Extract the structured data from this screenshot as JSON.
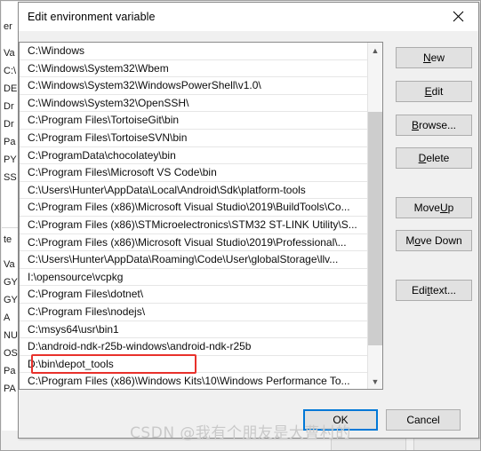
{
  "dialog": {
    "title": "Edit environment variable",
    "close_icon": "close-icon"
  },
  "background_window": {
    "left_text_fragments": [
      "er",
      "Va",
      "C:\\",
      "DE",
      "Dr",
      "Dr",
      "Pa",
      "PY",
      "SS",
      "te",
      "Va",
      "GY",
      "GY",
      "A",
      "NU",
      "OS",
      "Pa",
      "PA"
    ]
  },
  "path_list": {
    "items": [
      "C:\\Windows",
      "C:\\Windows\\System32\\Wbem",
      "C:\\Windows\\System32\\WindowsPowerShell\\v1.0\\",
      "C:\\Windows\\System32\\OpenSSH\\",
      "C:\\Program Files\\TortoiseGit\\bin",
      "C:\\Program Files\\TortoiseSVN\\bin",
      "C:\\ProgramData\\chocolatey\\bin",
      "C:\\Program Files\\Microsoft VS Code\\bin",
      "C:\\Users\\Hunter\\AppData\\Local\\Android\\Sdk\\platform-tools",
      "C:\\Program Files (x86)\\Microsoft Visual Studio\\2019\\BuildTools\\Co...",
      "C:\\Program Files (x86)\\STMicroelectronics\\STM32 ST-LINK Utility\\S...",
      "C:\\Program Files (x86)\\Microsoft Visual Studio\\2019\\Professional\\...",
      "C:\\Users\\Hunter\\AppData\\Roaming\\Code\\User\\globalStorage\\llv...",
      "I:\\opensource\\vcpkg",
      "C:\\Program Files\\dotnet\\",
      "C:\\Program Files\\nodejs\\",
      "C:\\msys64\\usr\\bin1",
      "D:\\android-ndk-r25b-windows\\android-ndk-r25b",
      "D:\\bin\\depot_tools",
      "C:\\Program Files (x86)\\Windows Kits\\10\\Windows Performance To...",
      "",
      ""
    ],
    "highlighted_index": 18,
    "highlight_color": "#e8312b",
    "scrollbar": {
      "up_arrow_icon": "chevron-up-icon",
      "down_arrow_icon": "chevron-down-icon",
      "thumb_top_percent": 17,
      "thumb_height_percent": 74
    }
  },
  "side_buttons": [
    {
      "id": "new",
      "label": "New",
      "accel": "N"
    },
    {
      "id": "edit",
      "label": "Edit",
      "accel": "E"
    },
    {
      "id": "browse",
      "label": "Browse...",
      "accel": "B"
    },
    {
      "id": "delete",
      "label": "Delete",
      "accel": "D"
    },
    {
      "id": "move-up",
      "label": "Move Up",
      "accel": "U"
    },
    {
      "id": "move-down",
      "label": "Move Down",
      "accel": "o"
    },
    {
      "id": "edit-text",
      "label": "Edit text...",
      "accel": "t"
    }
  ],
  "footer": {
    "ok_label": "OK",
    "cancel_label": "Cancel",
    "focus_color": "#0078d7"
  },
  "watermark": {
    "text": "CSDN @我有个朋友是大曹村的"
  }
}
